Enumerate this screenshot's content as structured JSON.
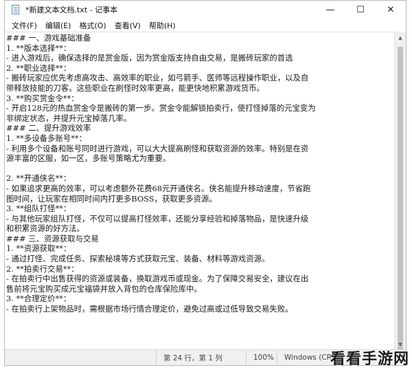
{
  "window": {
    "title": "*新建文本文档.txt - 记事本",
    "app_icon": "notepad-icon",
    "controls": {
      "minimize": "—",
      "maximize": "☐",
      "close": "✕"
    }
  },
  "menu": [
    {
      "label": "文件(F)"
    },
    {
      "label": "编辑(E)"
    },
    {
      "label": "格式(O)"
    },
    {
      "label": "查看(V)"
    },
    {
      "label": "帮助(H)"
    }
  ],
  "editor": {
    "lines": [
      "### 一、游戏基础准备",
      "1. **版本选择**：",
      "  - 进入游戏后，确保选择的是赏金版，因为赏金版支持自由交易，是搬砖玩家的首选",
      "2. **职业选择**：",
      "  - 搬砖玩家应优先考虑高攻击、高效率的职业，如弓箭手、医师等远程操作职业，以及自",
      "带释放技能的刀客。这些职业在刷怪时效率更高，能更快地积累游戏货币。",
      "3. **购买赏金令**：",
      "  - 开启128元的热血赏金令是搬砖的第一步。赏金令能解锁拍卖行，使打怪掉落的元宝变为",
      "非绑定状态，并提升元宝掉落几率。",
      "### 二、提升游戏效率",
      "1. **多设备多账号**：",
      "  - 利用多个设备和账号同时进行游戏，可以大大提高刷怪和获取资源的效率。特别是在资",
      "源丰富的区服，如一区，多账号策略尤为重要。",
      "",
      "2. **开通侠名**：",
      "  - 如果追求更高的效率，可以考虑额外花费68元开通侠名。侠名能提升移动速度，节省跑",
      "图时间，让玩家在相同时间内打更多BOSS，获取更多资源。",
      "3. **组队打怪**：",
      "  - 与其他玩家组队打怪，不仅可以提高打怪效率，还能分享经验和掉落物品，是快速升级",
      "和积累资源的好方法。",
      "### 三、资源获取与交易",
      "1. **资源获取**：",
      "  - 通过打怪、完成任务、探索秘境等方式获取元宝、装备、材料等游戏资源。",
      "2. **拍卖行交易**：",
      "  - 在拍卖行中出售获得的资源或装备，换取游戏币或现金。为了保障交易安全，建议在出",
      "售前将元宝购买成元宝福袋并放入背包的仓库保险库中。",
      "3. **合理定价**：",
      "  - 在拍卖行上架物品时，需根据市场行情合理定价，避免过高或过低导致交易失败。"
    ]
  },
  "statusbar": {
    "position": "第 24 行，第 1 列",
    "zoom": "100%",
    "encoding": "Windows (CRLF)"
  },
  "watermark": "看看手游网"
}
